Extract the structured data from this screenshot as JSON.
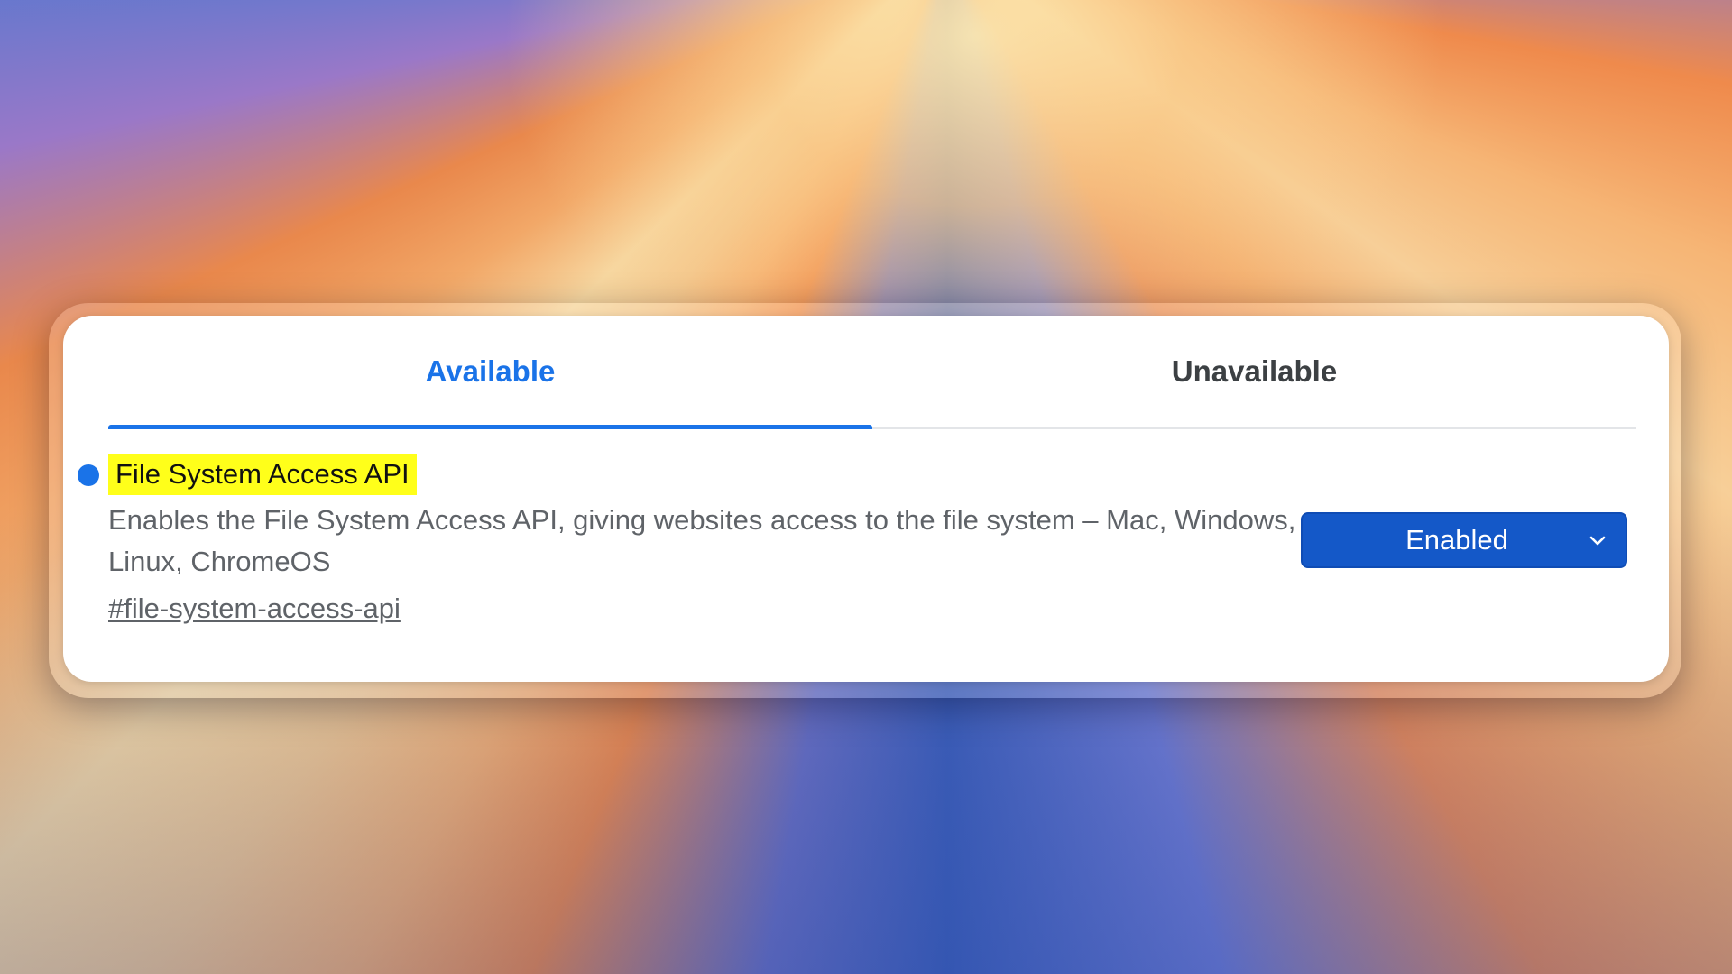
{
  "tabs": [
    {
      "label": "Available",
      "active": true
    },
    {
      "label": "Unavailable",
      "active": false
    }
  ],
  "flag": {
    "title": "File System Access API",
    "description": "Enables the File System Access API, giving websites access to the file system – Mac, Windows, Linux, ChromeOS",
    "link": "#file-system-access-api",
    "state": "Enabled",
    "highlight_color": "#ffff1a"
  },
  "colors": {
    "accent": "#1a73e8",
    "select_bg": "#1458c8"
  },
  "icons": {
    "status": "blue-dot-icon",
    "dropdown": "chevron-down-icon"
  }
}
